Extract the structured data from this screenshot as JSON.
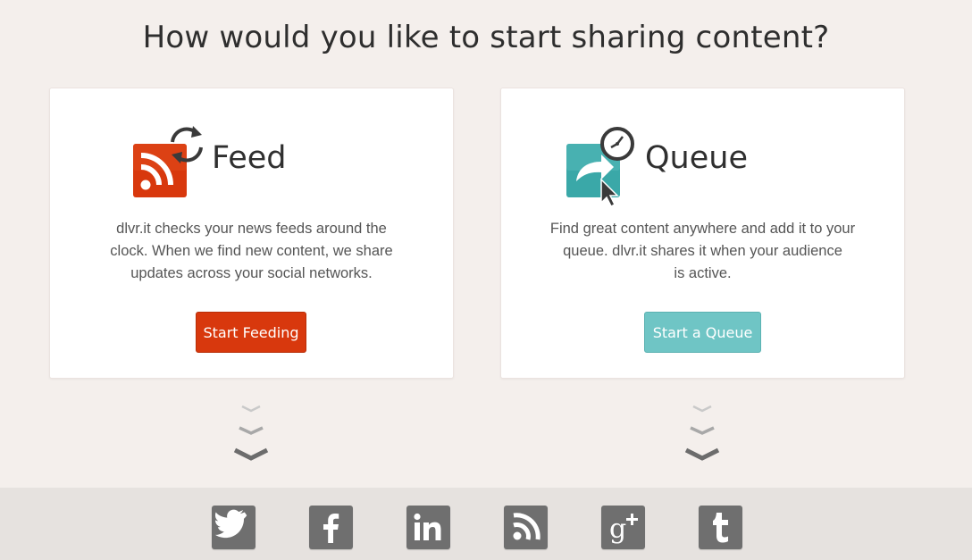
{
  "page": {
    "title": "How would you like to start sharing content?"
  },
  "feed_card": {
    "heading": "Feed",
    "description_lines": [
      "dlvr.it checks your news feeds around the",
      "clock. When we find new content, we share",
      "updates across your social networks."
    ],
    "button_label": "Start Feeding",
    "icons": [
      "rss-icon",
      "refresh-icon"
    ],
    "accent_color": "#d8380d"
  },
  "queue_card": {
    "heading": "Queue",
    "description_lines": [
      "Find great content anywhere and add it to your",
      "queue. dlvr.it shares it when your audience",
      "is active."
    ],
    "button_label": "Start a Queue",
    "icons": [
      "share-arrow-icon",
      "clock-icon",
      "cursor-icon"
    ],
    "accent_color": "#6fc5c5"
  },
  "social_bar": {
    "icons": [
      "twitter-icon",
      "facebook-icon",
      "linkedin-icon",
      "rss-icon",
      "google-plus-icon",
      "tumblr-icon"
    ],
    "button_color": "#6f6f6f"
  }
}
